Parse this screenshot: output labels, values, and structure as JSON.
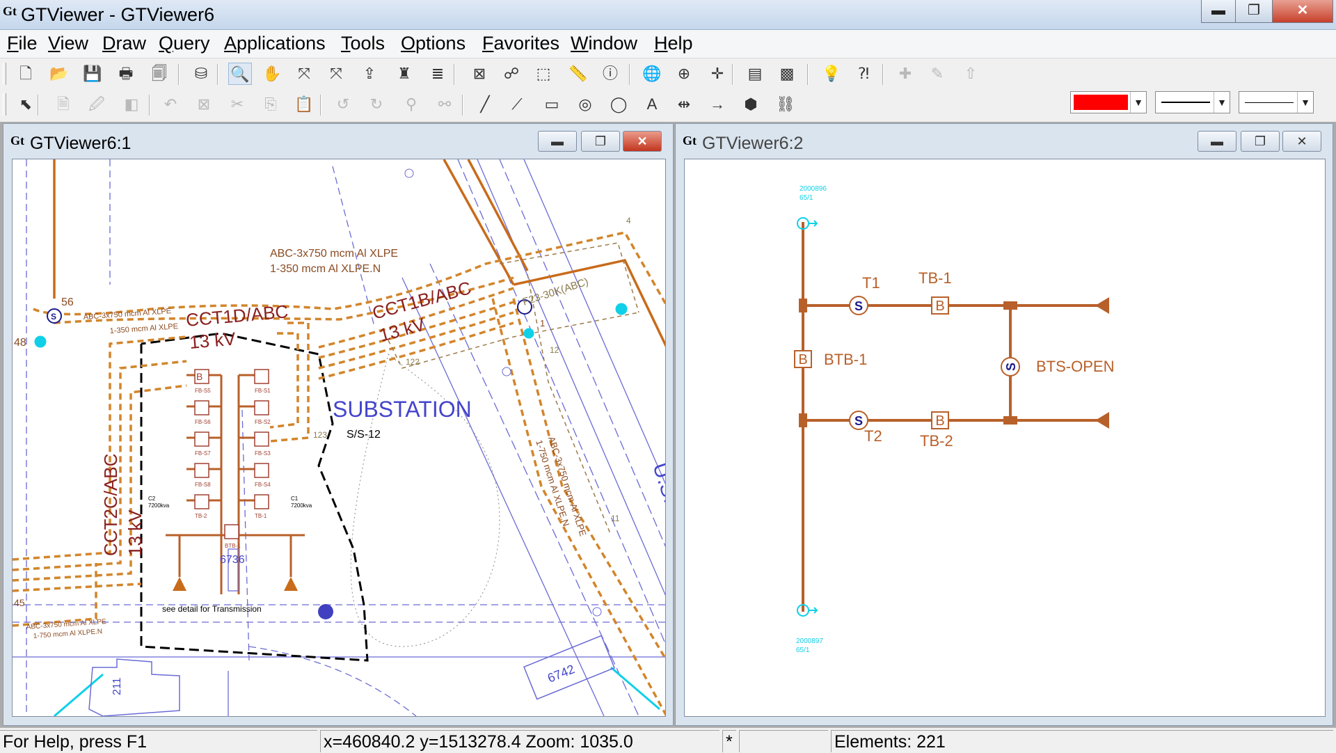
{
  "app": {
    "title": "GTViewer - GTViewer6",
    "icon": "gt-logo-icon",
    "window_controls": {
      "minimize": "▬",
      "maximize": "❐",
      "close": "✕"
    }
  },
  "menu": [
    "File",
    "View",
    "Draw",
    "Query",
    "Applications",
    "Tools",
    "Options",
    "Favorites",
    "Window",
    "Help"
  ],
  "toolbar1": [
    {
      "name": "new-document-icon",
      "glyph": "🗋"
    },
    {
      "name": "open-folder-icon",
      "glyph": "📂"
    },
    {
      "name": "save-icon",
      "glyph": "💾"
    },
    {
      "name": "print-icon",
      "glyph": "🖶"
    },
    {
      "name": "print-preview-icon",
      "glyph": "🗐"
    },
    {
      "name": "layers-tool-icon",
      "glyph": "⛁"
    },
    {
      "name": "zoom-icon",
      "glyph": "🔍"
    },
    {
      "name": "pan-hand-icon",
      "glyph": "✋"
    },
    {
      "name": "fit-view-icon",
      "glyph": "⤧"
    },
    {
      "name": "zoom-extents-red-icon",
      "glyph": "⤧"
    },
    {
      "name": "export-icon",
      "glyph": "⇪"
    },
    {
      "name": "bottle-icon",
      "glyph": "♜"
    },
    {
      "name": "stack-icon",
      "glyph": "≣"
    },
    {
      "name": "fit-all-icon",
      "glyph": "⊠"
    },
    {
      "name": "binoculars-icon",
      "glyph": "☍"
    },
    {
      "name": "select-rectangle-icon",
      "glyph": "⬚"
    },
    {
      "name": "measure-ruler-icon",
      "glyph": "📏"
    },
    {
      "name": "info-tooltip-icon",
      "glyph": "ⓘ"
    },
    {
      "name": "globe-icon",
      "glyph": "🌐"
    },
    {
      "name": "snap-target-icon",
      "glyph": "⊕"
    },
    {
      "name": "crosshair-icon",
      "glyph": "✛"
    },
    {
      "name": "color-palette-icon",
      "glyph": "▤"
    },
    {
      "name": "raster-icon",
      "glyph": "▩"
    },
    {
      "name": "help-bulb-icon",
      "glyph": "💡"
    },
    {
      "name": "context-help-icon",
      "glyph": "⁈"
    },
    {
      "name": "add-redline-icon",
      "glyph": "✚"
    },
    {
      "name": "edit-redline-icon",
      "glyph": "✎"
    },
    {
      "name": "publish-redline-icon",
      "glyph": "⇧"
    }
  ],
  "toolbar2": [
    {
      "name": "select-arrow-icon",
      "glyph": "⬉",
      "dim": false
    },
    {
      "name": "properties-icon",
      "glyph": "🗎",
      "dim": true
    },
    {
      "name": "edit-properties-icon",
      "glyph": "🖉",
      "dim": true
    },
    {
      "name": "window-split-icon",
      "glyph": "◧",
      "dim": true
    },
    {
      "name": "undo-icon",
      "glyph": "↶",
      "dim": true
    },
    {
      "name": "delete-icon",
      "glyph": "⊠",
      "dim": true
    },
    {
      "name": "cut-icon",
      "glyph": "✂",
      "dim": true
    },
    {
      "name": "copy-icon",
      "glyph": "⎘",
      "dim": true
    },
    {
      "name": "paste-icon",
      "glyph": "📋",
      "dim": true
    },
    {
      "name": "rotate-left-icon",
      "glyph": "↺",
      "dim": true
    },
    {
      "name": "rotate-right-icon",
      "glyph": "↻",
      "dim": true
    },
    {
      "name": "scale-icon",
      "glyph": "⚲",
      "dim": true
    },
    {
      "name": "link-nodes-icon",
      "glyph": "⚯",
      "dim": true
    },
    {
      "name": "draw-line-icon",
      "glyph": "╱",
      "dim": false
    },
    {
      "name": "draw-polyline-icon",
      "glyph": "⟋",
      "dim": false
    },
    {
      "name": "draw-rectangle-icon",
      "glyph": "▭",
      "dim": false
    },
    {
      "name": "draw-circle-icon",
      "glyph": "◎",
      "dim": false
    },
    {
      "name": "draw-ellipse-icon",
      "glyph": "◯",
      "dim": false
    },
    {
      "name": "draw-text-icon",
      "glyph": "A",
      "dim": false
    },
    {
      "name": "draw-dimension-icon",
      "glyph": "⇹",
      "dim": false
    },
    {
      "name": "draw-arrow-icon",
      "glyph": "→",
      "dim": false
    },
    {
      "name": "draw-symbol-icon",
      "glyph": "⬢",
      "dim": false
    },
    {
      "name": "draw-chain-icon",
      "glyph": "⛓",
      "dim": false
    }
  ],
  "style_controls": {
    "color": "#ff0000"
  },
  "windows": [
    {
      "title": "GTViewer6:1",
      "active": true
    },
    {
      "title": "GTViewer6:2",
      "active": false
    }
  ],
  "map": {
    "cable_label_1": "ABC-3x750 mcm Al XLPE",
    "cable_label_2": "1-350 mcm Al XLPE.N",
    "cct1d": "CCT1D/ABC",
    "cct1d_kv": "13 kV",
    "cct1b": "CCT1B/ABC",
    "cct1b_kv": "13 kV",
    "cct2c": "CCT2C/ABC",
    "cct2c_kv": "13 kV",
    "substation": "SUBSTATION",
    "substation_id": "S/S-12",
    "num_56": "56",
    "num_48": "48",
    "num_45": "45",
    "num_6736": "6736",
    "num_6742": "6742",
    "num_211": "211",
    "num_123": "123",
    "num_122": "122",
    "num_4": "4",
    "num_1": "1",
    "num_12": "12",
    "num_11": "11",
    "f23": "F23-30K(ABC)",
    "small_left_1": "ABC-3x750 mcm Al XLPE",
    "small_left_2": "1-350 mcm Al XLPE",
    "small_low_1": "ABC-3x750 mcm Al XLPE",
    "small_low_2": "1-750 mcm Al XLPE.N",
    "road_label_1": "ABC-3x750 mcm Al XLPE",
    "road_label_2": "1-750 mcm Al XLPE.N",
    "see_detail": "see detail for Transmission",
    "us": "U.S.",
    "fb_labels": [
      "FB-S5",
      "FB-S6",
      "FB-S7",
      "FB-S8",
      "TB-2",
      "FB-S1",
      "FB-S2",
      "FB-S3",
      "FB-S4",
      "TB-1",
      "BTB-1"
    ],
    "xfmr_c2": "C2",
    "xfmr_c2_kva": "7200kva",
    "xfmr_c1": "C1",
    "xfmr_c1_kva": "7200kva",
    "bus_letter": "B",
    "switch_letter": "S"
  },
  "schematic": {
    "top_id": "2000896",
    "top_sub": "65/1",
    "bottom_id": "2000897",
    "bottom_sub": "65/1",
    "t1": "T1",
    "t2": "T2",
    "tb1": "TB-1",
    "tb2": "TB-2",
    "btb1": "BTB-1",
    "bts_open": "BTS-OPEN"
  },
  "status": {
    "help": "For Help, press F1",
    "coords": "x=460840.2 y=1513278.4  Zoom: 1035.0",
    "flag": "*",
    "empty": "",
    "elements": "Elements: 221"
  }
}
